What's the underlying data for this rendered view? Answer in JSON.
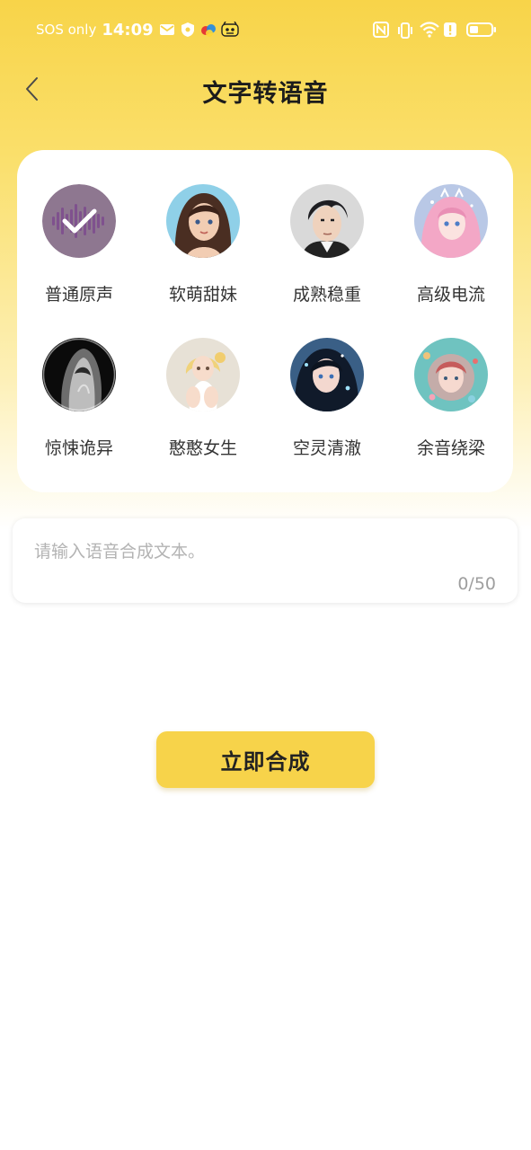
{
  "status_bar": {
    "carrier": "SOS only",
    "time": "14:09",
    "left_icons": [
      "mail-icon",
      "shield-icon",
      "app-logo-icon",
      "game-mascot-icon"
    ],
    "right_icons": [
      "nfc-icon",
      "vibrate-icon",
      "wifi-icon",
      "alert-icon",
      "battery-icon"
    ]
  },
  "header": {
    "back_icon": "chevron-left-icon",
    "title": "文字转语音"
  },
  "voices": [
    {
      "label": "普通原声",
      "selected": true,
      "icon": "voice-wave-check-icon"
    },
    {
      "label": "软萌甜妹",
      "selected": false
    },
    {
      "label": "成熟稳重",
      "selected": false
    },
    {
      "label": "高级电流",
      "selected": false
    },
    {
      "label": "惊悚诡异",
      "selected": false
    },
    {
      "label": "憨憨女生",
      "selected": false
    },
    {
      "label": "空灵清澈",
      "selected": false
    },
    {
      "label": "余音绕梁",
      "selected": false
    }
  ],
  "text_input": {
    "placeholder": "请输入语音合成文本。",
    "value": "",
    "counter": "0/50"
  },
  "actions": {
    "synthesize_label": "立即合成"
  },
  "colors": {
    "accent": "#f7d34a",
    "header_gradient_top": "#f8d449",
    "selected_avatar": "#8e7790"
  }
}
